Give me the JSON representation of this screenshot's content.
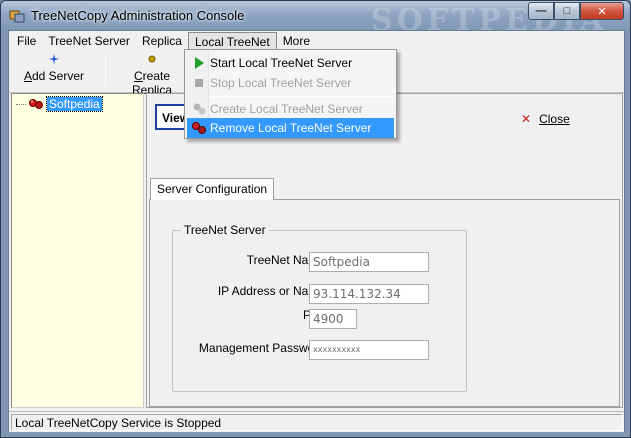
{
  "window": {
    "title": "TreeNetCopy Administration Console",
    "watermark": "SOFTPEDIA",
    "buttons": {
      "minimize": "—",
      "maximize": "□",
      "close": "✕"
    }
  },
  "menu": {
    "items": [
      "File",
      "TreeNet Server",
      "Replica",
      "Local TreeNet",
      "More"
    ],
    "open_index": 3
  },
  "toolbar": {
    "add_server": {
      "label_first": "A",
      "label_rest": "dd Server"
    },
    "create_replica": {
      "label_first": "C",
      "label_rest": "reate Replica"
    }
  },
  "dropdown": {
    "items": [
      {
        "label": "Start Local TreeNet Server",
        "enabled": true,
        "icon": "play-icon"
      },
      {
        "label": "Stop Local TreeNet Server",
        "enabled": false,
        "icon": "stop-icon"
      },
      {
        "label": "Create Local TreeNet Server",
        "enabled": false,
        "icon": "create-server-icon"
      },
      {
        "label": "Remove Local TreeNet Server",
        "enabled": true,
        "icon": "remove-server-icon",
        "highlighted": true
      }
    ]
  },
  "tree": {
    "selected_node": "Softpedia"
  },
  "main": {
    "view_button": "View",
    "close_label_first": "C",
    "close_label_rest": "lose",
    "tab_label": "Server Configuration",
    "group_title": "TreeNet Server",
    "fields": {
      "name_label": "TreeNet Name",
      "name_value": "Softpedia",
      "ip_label": "IP Address or Name",
      "ip_value": "93.114.132.34",
      "port_label": "Port",
      "port_value": "4900",
      "password_label": "Management Password",
      "password_value": "xxxxxxxxxx"
    }
  },
  "status": {
    "text": "Local TreeNetCopy Service is Stopped"
  },
  "colors": {
    "selection": "#3399ff",
    "tree_bg": "#ffffe1",
    "close_x": "#d31f1f"
  }
}
